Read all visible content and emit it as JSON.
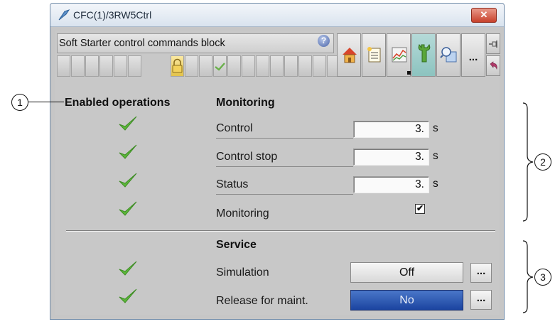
{
  "window": {
    "title": "CFC(1)/3RW5Ctrl",
    "close_glyph": "✕"
  },
  "toolbar": {
    "block_name": "Soft Starter control commands block",
    "help_glyph": "?",
    "more_label": "...",
    "nav_icons": [
      "home-icon",
      "report-icon",
      "trend-icon",
      "service-icon",
      "zoom-icon"
    ],
    "pin_icon": "pin-icon",
    "undo_icon": "undo-icon"
  },
  "enabled_operations": {
    "header": "Enabled operations"
  },
  "monitoring": {
    "header": "Monitoring",
    "rows": [
      {
        "label": "Control",
        "value": "3.",
        "unit": "s"
      },
      {
        "label": "Control stop",
        "value": "3.",
        "unit": "s"
      },
      {
        "label": "Status",
        "value": "3.",
        "unit": "s"
      }
    ],
    "monitoring_label": "Monitoring",
    "monitoring_checked": true
  },
  "service": {
    "header": "Service",
    "simulation_label": "Simulation",
    "simulation_value": "Off",
    "release_label": "Release for maint.",
    "release_value": "No",
    "ellipsis": "..."
  },
  "callouts": {
    "c1": "1",
    "c2": "2",
    "c3": "3"
  },
  "colors": {
    "check_green": "#5cb83a",
    "release_blue": "#2a55b0",
    "panel_gray": "#c8c8c8"
  }
}
